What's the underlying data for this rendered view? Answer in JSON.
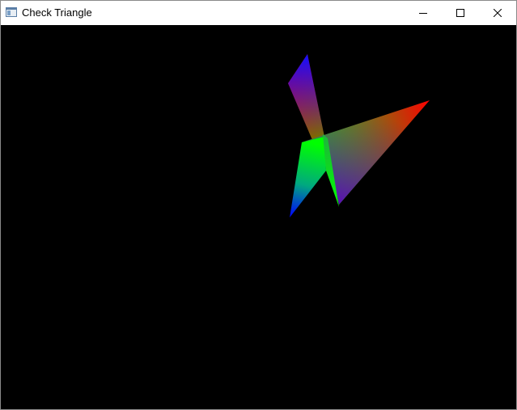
{
  "window": {
    "title": "Check Triangle",
    "icon": "app-window-icon",
    "controls": {
      "minimize_icon": "minimize-icon",
      "maximize_icon": "maximize-icon",
      "close_icon": "close-icon"
    }
  },
  "scene": {
    "background": "#000000",
    "vertex_colors": [
      "#ff0000",
      "#00ff00",
      "#0000ff"
    ]
  }
}
